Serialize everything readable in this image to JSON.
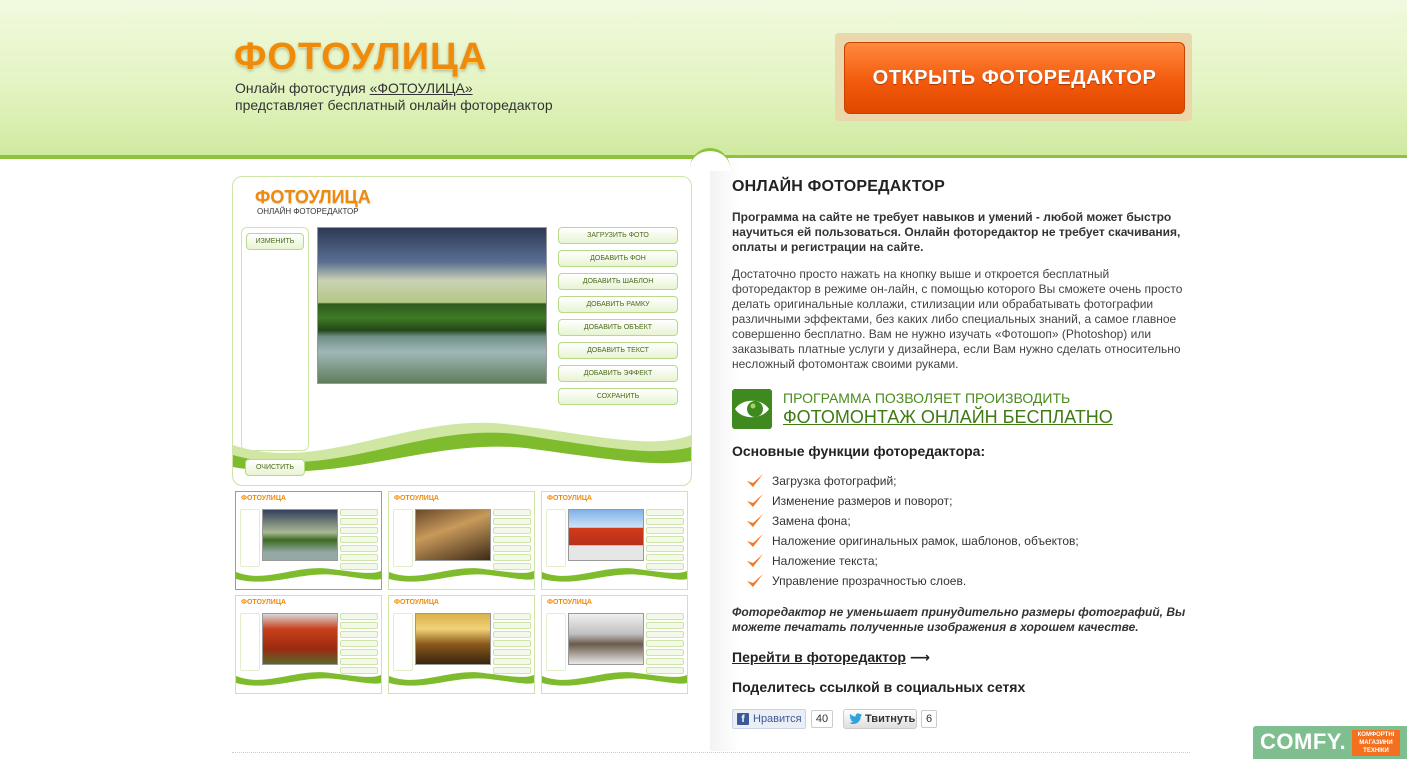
{
  "header": {
    "logo": "ФОТОУЛИЦА",
    "tagline_prefix": "Онлайн фотостудия ",
    "tagline_link": "«ФОТОУЛИЦА»",
    "tagline_line2": "представляет бесплатный онлайн фоторедактор",
    "cta_label": "ОТКРЫТЬ ФОТОРЕДАКТОР"
  },
  "preview": {
    "logo": "ФОТОУЛИЦА",
    "subtitle": "ОНЛАЙН ФОТОРЕДАКТОР",
    "change_label": "ИЗМЕНИТЬ",
    "clear_label": "ОЧИСТИТЬ",
    "buttons": [
      "ЗАГРУЗИТЬ ФОТО",
      "ДОБАВИТЬ ФОН",
      "ДОБАВИТЬ ШАБЛОН",
      "ДОБАВИТЬ РАМКУ",
      "ДОБАВИТЬ ОБЪЕКТ",
      "ДОБАВИТЬ ТЕКСТ",
      "ДОБАВИТЬ ЭФФЕКТ",
      "СОХРАНИТЬ"
    ],
    "thumb_logo": "ФОТОУЛИЦА"
  },
  "content": {
    "title": "ОНЛАЙН ФОТОРЕДАКТОР",
    "lead": "Программа на сайте не требует навыков и умений - любой может быстро научиться ей пользоваться. Онлайн фоторедактор не требует скачивания, оплаты и регистрации на сайте.",
    "description": "Достаточно просто нажать на кнопку выше и откроется бесплатный фоторедактор в режиме он-лайн, с помощью которого Вы сможете очень просто делать оригинальные коллажи, стилизации или обрабатывать фотографии различными эффектами, без каких либо специальных знаний, а самое главное совершенно бесплатно. Вам не нужно изучать «Фотошоп» (Photoshop) или заказывать платные услуги у дизайнера, если Вам нужно сделать относительно несложный фотомонтаж своими руками.",
    "promo_top": "ПРОГРАММА ПОЗВОЛЯЕТ ПРОИЗВОДИТЬ",
    "promo_link": "ФОТОМОНТАЖ ОНЛАЙН БЕСПЛАТНО",
    "features_title": "Основные функции фоторедактора:",
    "features": [
      "Загрузка фотографий;",
      "Изменение размеров и поворот;",
      "Замена фона;",
      "Наложение оригинальных рамок, шаблонов, объектов;",
      "Наложение текста;",
      "Управление прозрачностью слоев."
    ],
    "note": "Фоторедактор не уменьшает принудительно размеры фотографий, Вы можете печатать полученные изображения в хорошем качестве.",
    "go_link": "Перейти в фоторедактор",
    "go_arrow": "⟶",
    "share_title": "Поделитесь ссылкой в социальных сетях"
  },
  "social": {
    "fb_label": "Нравится",
    "fb_count": "40",
    "tw_label": "Твитнуть",
    "tw_count": "6"
  },
  "badge": {
    "word": "COMFY.",
    "sub": "КОМФОРТНІ МАГАЗИНИ ТЕХНІКИ"
  },
  "colors": {
    "accent_orange": "#f35a0d",
    "brand_green": "#8cc33e",
    "link_green": "#3f7a14"
  }
}
